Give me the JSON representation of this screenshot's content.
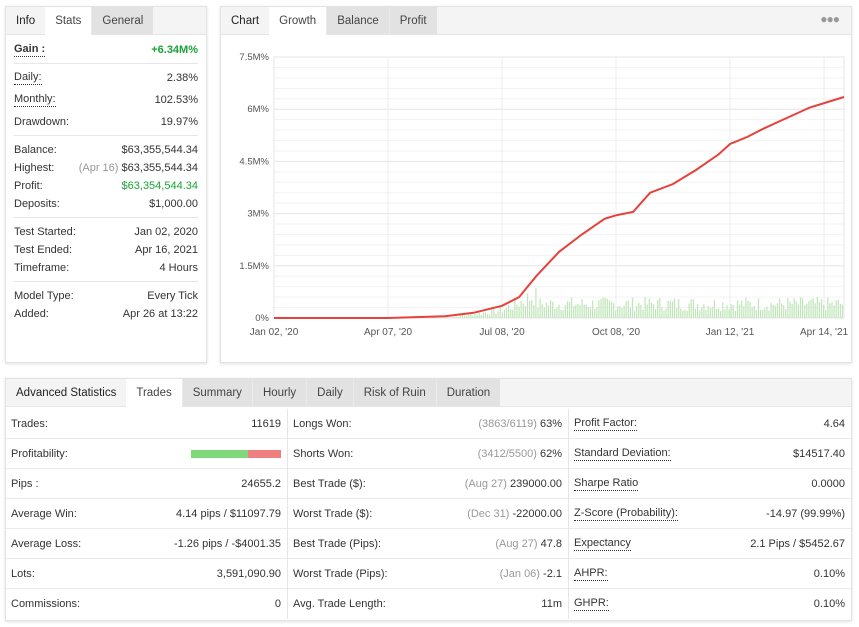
{
  "left_panel": {
    "tabs": [
      {
        "label": "Info",
        "state": "title"
      },
      {
        "label": "Stats",
        "state": "active"
      },
      {
        "label": "General",
        "state": "inactive"
      }
    ],
    "gain": {
      "label": "Gain :",
      "value": "+6.34M%"
    },
    "rates": [
      {
        "label": "Daily:",
        "value": "2.38%"
      },
      {
        "label": "Monthly:",
        "value": "102.53%"
      },
      {
        "label": "Drawdown:",
        "value": "19.97%"
      }
    ],
    "balance": {
      "label": "Balance:",
      "value": "$63,355,544.34"
    },
    "highest": {
      "label": "Highest:",
      "date": "(Apr 16)",
      "value": "$63,355,544.34"
    },
    "profit": {
      "label": "Profit:",
      "value": "$63,354,544.34"
    },
    "deposits": {
      "label": "Deposits:",
      "value": "$1,000.00"
    },
    "test": [
      {
        "label": "Test Started:",
        "value": "Jan 02, 2020"
      },
      {
        "label": "Test Ended:",
        "value": "Apr 16, 2021"
      },
      {
        "label": "Timeframe:",
        "value": "4 Hours"
      }
    ],
    "model": [
      {
        "label": "Model Type:",
        "value": "Every Tick"
      },
      {
        "label": "Added:",
        "value": "Apr 26 at 13:22"
      }
    ]
  },
  "chart_panel": {
    "tabs": [
      {
        "label": "Chart",
        "state": "title"
      },
      {
        "label": "Growth",
        "state": "active"
      },
      {
        "label": "Balance",
        "state": "inactive"
      },
      {
        "label": "Profit",
        "state": "inactive"
      }
    ],
    "menu_icon": "more-dots-icon"
  },
  "chart_data": {
    "type": "line",
    "title": "Growth",
    "xlabel": "",
    "ylabel": "",
    "y_ticks": [
      "0%",
      "1.5M%",
      "3M%",
      "4.5M%",
      "6M%",
      "7.5M%"
    ],
    "y_tick_values": [
      0,
      1.5,
      3,
      4.5,
      6,
      7.5
    ],
    "ylim": [
      0,
      7.5
    ],
    "y_unit": "M%",
    "x_ticks": [
      "Jan 02, '20",
      "Apr 07, '20",
      "Jul 08, '20",
      "Oct 08, '20",
      "Jan 12, '21",
      "Apr 14, '21"
    ],
    "x_tick_positions": [
      0,
      0.2,
      0.4,
      0.6,
      0.8,
      0.965
    ],
    "grid": true,
    "series": [
      {
        "name": "Growth",
        "color": "#e8403a",
        "x": [
          0,
          0.1,
          0.2,
          0.3,
          0.35,
          0.4,
          0.43,
          0.46,
          0.5,
          0.54,
          0.58,
          0.6,
          0.63,
          0.66,
          0.7,
          0.74,
          0.78,
          0.8,
          0.83,
          0.86,
          0.9,
          0.94,
          0.98,
          1.0
        ],
        "values": [
          0,
          0.0,
          0.0,
          0.05,
          0.15,
          0.35,
          0.6,
          1.2,
          1.9,
          2.4,
          2.85,
          2.95,
          3.05,
          3.6,
          3.85,
          4.25,
          4.7,
          5.0,
          5.2,
          5.45,
          5.75,
          6.05,
          6.25,
          6.35
        ]
      },
      {
        "name": "Volume",
        "type": "bar",
        "color": "#bfe5b8",
        "range_start": 0.3,
        "range_end": 1.0,
        "max_value": 0.85
      }
    ]
  },
  "advanced": {
    "tabs": [
      {
        "label": "Advanced Statistics",
        "state": "title"
      },
      {
        "label": "Trades",
        "state": "active"
      },
      {
        "label": "Summary",
        "state": "inactive"
      },
      {
        "label": "Hourly",
        "state": "inactive"
      },
      {
        "label": "Daily",
        "state": "inactive"
      },
      {
        "label": "Risk of Ruin",
        "state": "inactive"
      },
      {
        "label": "Duration",
        "state": "inactive"
      }
    ],
    "col1": [
      {
        "label": "Trades:",
        "value": "11619"
      },
      {
        "label": "Profitability:",
        "value": "",
        "profitability_win_fraction": 0.63
      },
      {
        "label": "Pips :",
        "value": "24655.2"
      },
      {
        "label": "Average Win:",
        "value": "4.14 pips / $11097.79"
      },
      {
        "label": "Average Loss:",
        "value": "-1.26 pips / -$4001.35"
      },
      {
        "label": "Lots:",
        "value": "3,591,090.90"
      },
      {
        "label": "Commissions:",
        "value": "0"
      }
    ],
    "col2": [
      {
        "label": "Longs Won:",
        "note": "(3863/6119)",
        "value": "63%"
      },
      {
        "label": "Shorts Won:",
        "note": "(3412/5500)",
        "value": "62%"
      },
      {
        "label": "Best Trade ($):",
        "note": "(Aug 27)",
        "value": "239000.00"
      },
      {
        "label": "Worst Trade ($):",
        "note": "(Dec 31)",
        "value": "-22000.00"
      },
      {
        "label": "Best Trade (Pips):",
        "note": "(Aug 27)",
        "value": "47.8"
      },
      {
        "label": "Worst Trade (Pips):",
        "note": "(Jan 06)",
        "value": "-2.1"
      },
      {
        "label": "Avg. Trade Length:",
        "note": "",
        "value": "11m"
      }
    ],
    "col3": [
      {
        "label": "Profit Factor:",
        "value": "4.64"
      },
      {
        "label": "Standard Deviation:",
        "value": "$14517.40"
      },
      {
        "label": "Sharpe Ratio",
        "value": "0.0000"
      },
      {
        "label": "Z-Score (Probability):",
        "value": "-14.97 (99.99%)"
      },
      {
        "label": "Expectancy",
        "value": "2.1 Pips / $5452.67"
      },
      {
        "label": "AHPR:",
        "value": "0.10%"
      },
      {
        "label": "GHPR:",
        "value": "0.10%"
      }
    ]
  }
}
